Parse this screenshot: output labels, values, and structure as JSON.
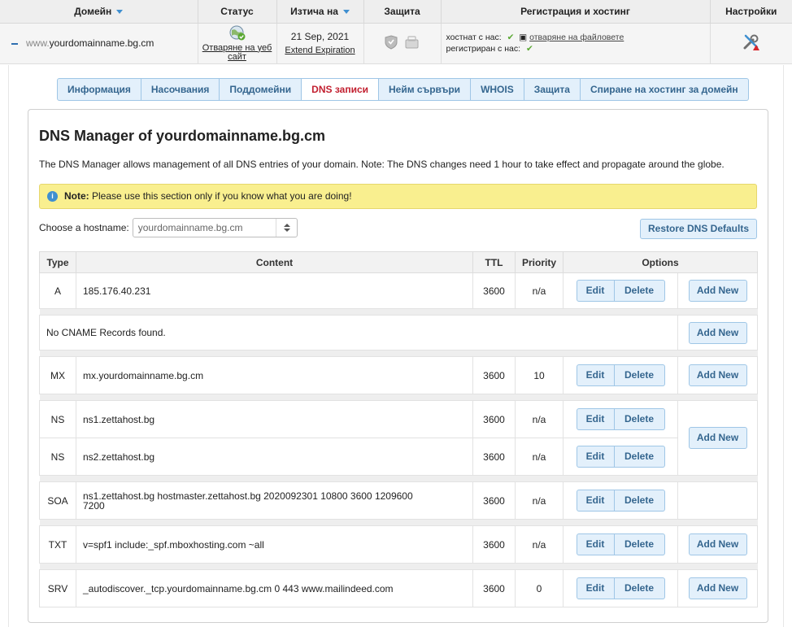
{
  "header": {
    "columns": [
      "Домейн",
      "Статус",
      "Изтича на",
      "Защита",
      "Регистрация и хостинг",
      "Настройки"
    ]
  },
  "domain_row": {
    "www": "www.",
    "domain": "yourdomainname.bg.cm",
    "status_link": "Отваряне на уеб сайт",
    "expiry_date": "21 Sep, 2021",
    "extend_link": "Extend Expiration",
    "hosted_label": "хостнат с нас:",
    "hosted_link": "отваряне на файловете",
    "registered_label": "регистриран с нас:"
  },
  "tabs": [
    {
      "label": "Информация",
      "active": false
    },
    {
      "label": "Насочвания",
      "active": false
    },
    {
      "label": "Поддомейни",
      "active": false
    },
    {
      "label": "DNS записи",
      "active": true
    },
    {
      "label": "Нейм сървъри",
      "active": false
    },
    {
      "label": "WHOIS",
      "active": false
    },
    {
      "label": "Защита",
      "active": false
    },
    {
      "label": "Спиране на хостинг за домейн",
      "active": false
    }
  ],
  "dns": {
    "title": "DNS Manager of yourdomainname.bg.cm",
    "description": "The DNS Manager allows management of all DNS entries of your domain. Note: The DNS changes need 1 hour to take effect and propagate around the globe.",
    "note_label": "Note:",
    "note_text": "Please use this section only if you know what you are doing!",
    "hostname_label": "Choose a hostname:",
    "hostname_value": "yourdomainname.bg.cm",
    "restore_label": "Restore DNS Defaults",
    "columns": {
      "type": "Type",
      "content": "Content",
      "ttl": "TTL",
      "priority": "Priority",
      "options": "Options"
    },
    "edit_label": "Edit",
    "delete_label": "Delete",
    "add_label": "Add New",
    "cname_empty": "No CNAME Records found.",
    "records": {
      "a": {
        "type": "A",
        "content": "185.176.40.231",
        "ttl": "3600",
        "priority": "n/a"
      },
      "mx": {
        "type": "MX",
        "content": "mx.yourdomainname.bg.cm",
        "ttl": "3600",
        "priority": "10"
      },
      "ns1": {
        "type": "NS",
        "content": "ns1.zettahost.bg",
        "ttl": "3600",
        "priority": "n/a"
      },
      "ns2": {
        "type": "NS",
        "content": "ns2.zettahost.bg",
        "ttl": "3600",
        "priority": "n/a"
      },
      "soa": {
        "type": "SOA",
        "content": "ns1.zettahost.bg hostmaster.zettahost.bg 2020092301 10800 3600 1209600 7200",
        "ttl": "3600",
        "priority": "n/a"
      },
      "txt": {
        "type": "TXT",
        "content": "v=spf1 include:_spf.mboxhosting.com ~all",
        "ttl": "3600",
        "priority": "n/a"
      },
      "srv": {
        "type": "SRV",
        "content": "_autodiscover._tcp.yourdomainname.bg.cm 0 443 www.mailindeed.com",
        "ttl": "3600",
        "priority": "0"
      }
    }
  }
}
